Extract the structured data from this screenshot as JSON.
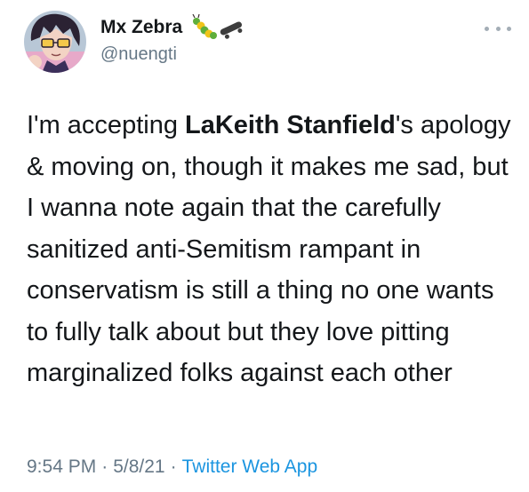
{
  "user": {
    "display_name": "Mx Zebra",
    "handle": "@nuengti",
    "avatar_icon": "anime-avatar-icon",
    "name_emojis": [
      "caterpillar-icon",
      "skateboard-icon"
    ]
  },
  "tweet": {
    "text_before": "I'm accepting ",
    "bold_name": "LaKeith Stanfield",
    "text_after": "'s apology & moving on, though it makes me sad, but I wanna note again that the carefully sanitized anti-Semitism rampant in conservatism is still a thing no one wants to fully talk about but they love pitting marginalized folks against each other"
  },
  "meta": {
    "time": "9:54 PM",
    "date": "5/8/21",
    "separator": "·",
    "source": "Twitter Web App"
  },
  "colors": {
    "text": "#14171a",
    "secondary": "#657786",
    "link": "#1b95e0"
  }
}
